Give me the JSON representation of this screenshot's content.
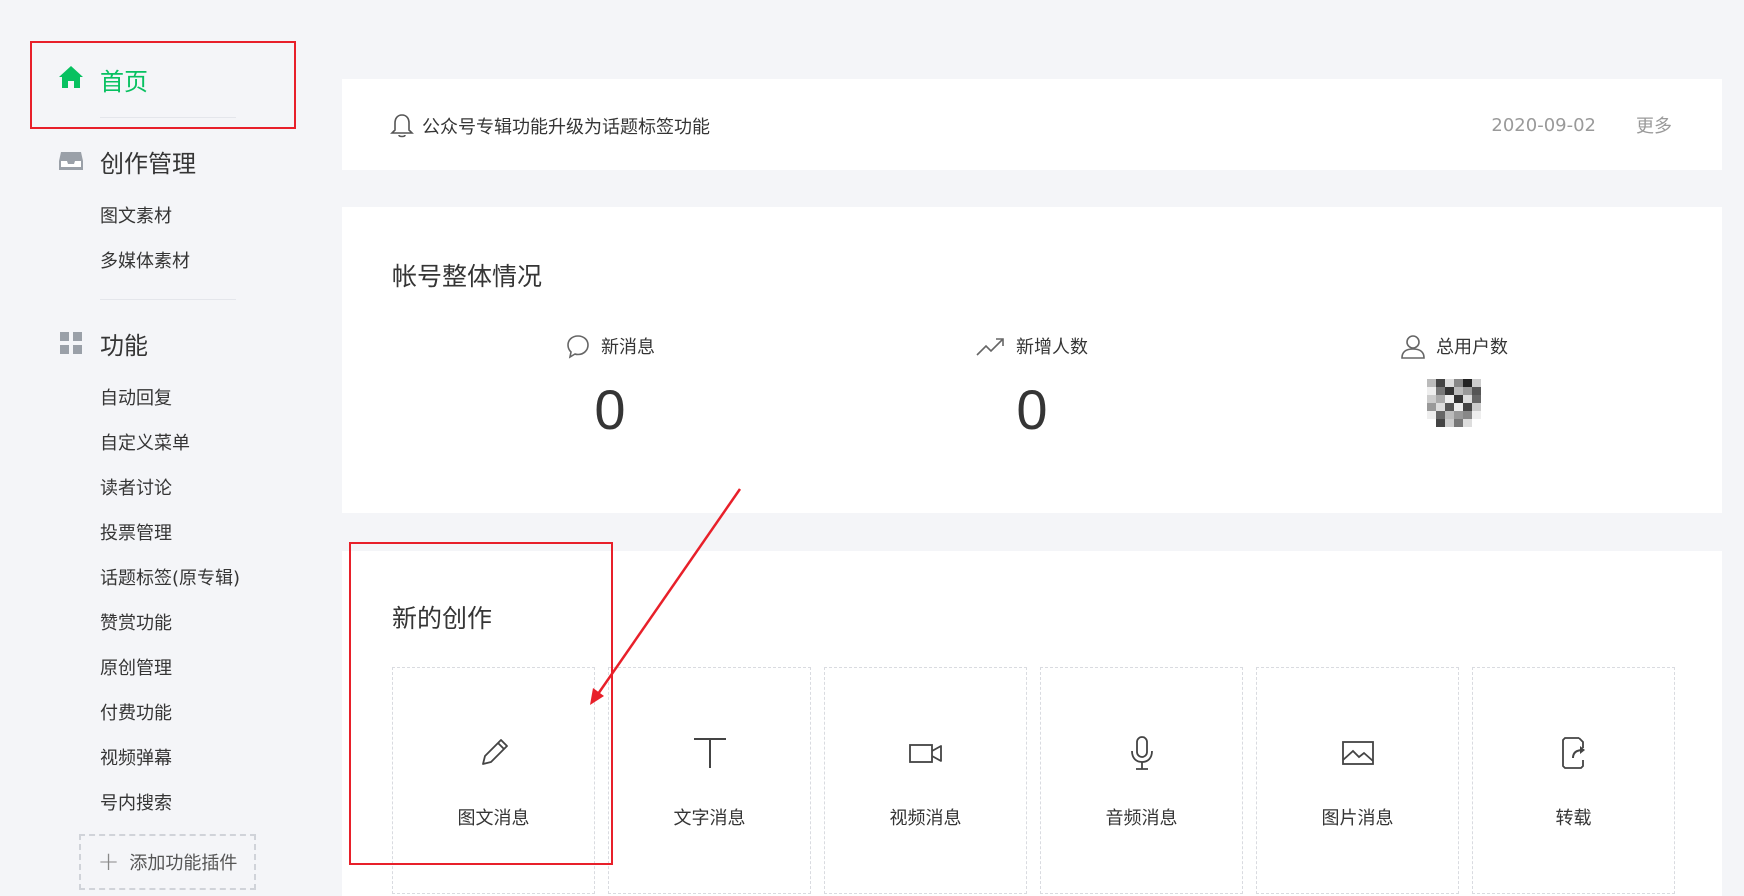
{
  "sidebar": {
    "home": "首页",
    "creation_title": "创作管理",
    "creation_items": [
      "图文素材",
      "多媒体素材"
    ],
    "features_title": "功能",
    "feature_items": [
      "自动回复",
      "自定义菜单",
      "读者讨论",
      "投票管理",
      "话题标签(原专辑)",
      "赞赏功能",
      "原创管理",
      "付费功能",
      "视频弹幕",
      "号内搜索"
    ],
    "add_plugin": "添加功能插件"
  },
  "notice": {
    "text": "公众号专辑功能升级为话题标签功能",
    "date": "2020-09-02",
    "more": "更多"
  },
  "overview": {
    "title": "帐号整体情况",
    "stats": [
      {
        "label": "新消息",
        "value": "0"
      },
      {
        "label": "新增人数",
        "value": "0"
      },
      {
        "label": "总用户数",
        "value": ""
      }
    ]
  },
  "create": {
    "title": "新的创作",
    "tiles": [
      "图文消息",
      "文字消息",
      "视频消息",
      "音频消息",
      "图片消息",
      "转载"
    ]
  },
  "colors": {
    "accent": "#07c160",
    "annotation": "#e8202a"
  }
}
